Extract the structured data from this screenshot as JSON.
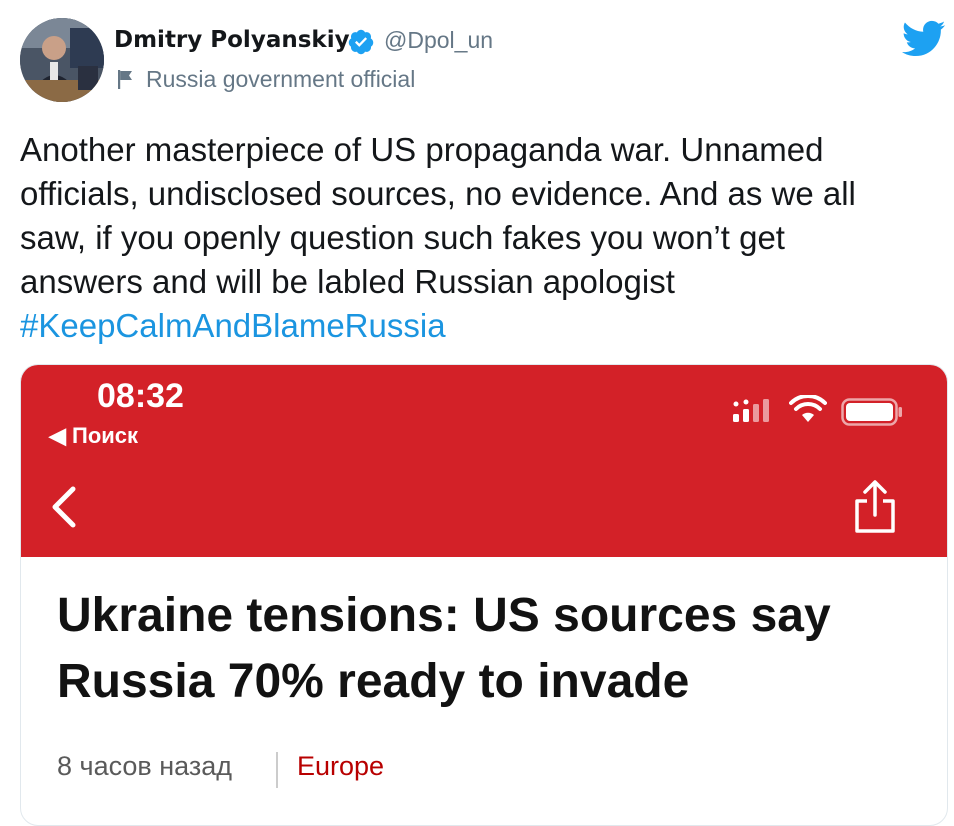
{
  "author": {
    "name": "Dmitry Polyanskiy",
    "handle": "@Dpol_un",
    "label": "Russia government official"
  },
  "tweet": {
    "lines": [
      "Another masterpiece of US propaganda war. Unnamed",
      "officials, undisclosed sources, no evidence. And as we all",
      "saw, if you openly question such fakes you won’t get",
      "answers and will be labled Russian apologist"
    ],
    "hashtag": "#KeepCalmAndBlameRussia"
  },
  "screenshot": {
    "time": "08:32",
    "back_label": "◀ Поиск",
    "headline_lines": [
      "Ukraine tensions: US sources say",
      "Russia 70% ready to invade"
    ],
    "timestamp": "8 часов назад",
    "category": "Europe"
  },
  "colors": {
    "twitter_blue": "#1da1f2",
    "hashtag": "#1b95e0",
    "bbc_red": "#d32128",
    "category_red": "#b80000",
    "secondary_text": "#657786"
  },
  "icons": [
    "verified-badge-icon",
    "flag-icon",
    "twitter-bird-icon",
    "cellular-signal-icon",
    "wifi-icon",
    "battery-icon",
    "chevron-left-icon",
    "share-icon"
  ]
}
